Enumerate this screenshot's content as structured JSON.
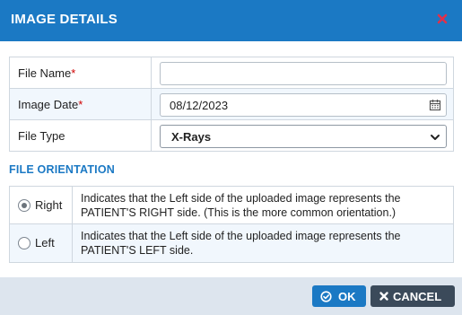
{
  "dialog": {
    "title": "IMAGE DETAILS",
    "close_icon": "close-icon"
  },
  "form": {
    "file_name": {
      "label": "File Name",
      "required": "*",
      "value": ""
    },
    "image_date": {
      "label": "Image Date",
      "required": "*",
      "value": "08/12/2023",
      "icon": "calendar-icon"
    },
    "file_type": {
      "label": "File Type",
      "value": "X-Rays",
      "icon": "chevron-down-icon"
    }
  },
  "orientation": {
    "title": "FILE ORIENTATION",
    "options": [
      {
        "label": "Right",
        "selected": true,
        "description": "Indicates that the Left side of the uploaded image represents the PATIENT'S RIGHT side. (This is the more common orientation.)"
      },
      {
        "label": "Left",
        "selected": false,
        "description": "Indicates that the Left side of the uploaded image represents the PATIENT'S LEFT side."
      }
    ]
  },
  "footer": {
    "ok_label": "OK",
    "cancel_label": "CANCEL"
  },
  "colors": {
    "header": "#1b79c4",
    "close": "#e0304a",
    "ok_button": "#1b79c4",
    "cancel_button": "#3b4a5a",
    "footer_bg": "#dde5ee"
  }
}
